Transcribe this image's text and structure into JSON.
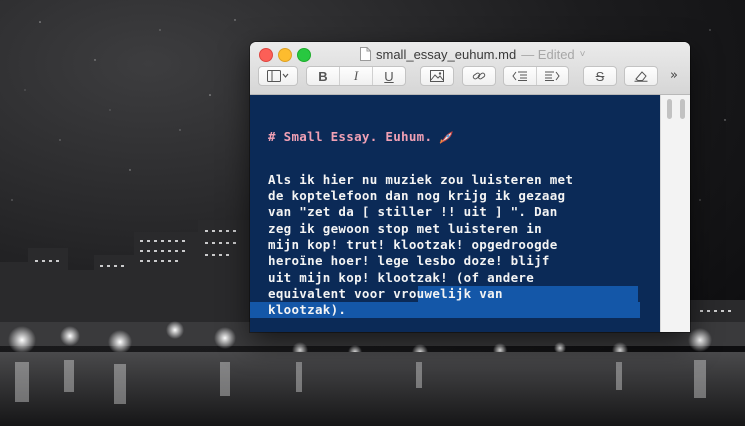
{
  "window": {
    "filename": "small_essay_euhum.md",
    "status": "— Edited",
    "status_chevron": "˅"
  },
  "toolbar": {
    "sidebar_toggle_icon": "sidebar-panel-icon",
    "bold": "B",
    "italic": "I",
    "underline": "U",
    "image_icon": "image-icon",
    "link_icon": "link-icon",
    "outdent_icon": "outdent-icon",
    "indent_icon": "indent-icon",
    "strikethrough": "S",
    "clear_format_icon": "eraser-icon",
    "overflow": "»"
  },
  "editor": {
    "background": "#0b2a57",
    "selection_color": "#1457a8",
    "heading": "# Small Essay. Euhum.",
    "heading_emoji": "rocket-icon",
    "lines": [
      "Als ik hier nu muziek zou luisteren met",
      "de koptelefoon dan nog krijg ik gezaag",
      "van \"zet da [ stiller !! uit ] \". Dan",
      "zeg ik gewoon stop met luisteren in",
      "mijn kop! trut! klootzak! opgedroogde",
      "heroïne hoer! lege lesbo doze! blijf",
      "uit mijn kop! klootzak! (of andere",
      "equivalent voor vrouwelijk van",
      "klootzak)."
    ]
  }
}
